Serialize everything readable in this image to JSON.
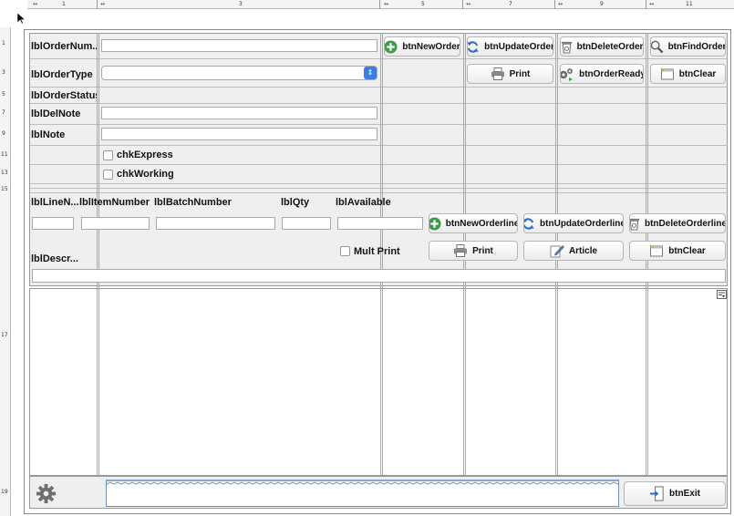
{
  "ruler": {
    "marks": [
      "1",
      "3",
      "5",
      "7",
      "9",
      "11"
    ],
    "left_marks": [
      "1",
      "3",
      "5",
      "7",
      "9",
      "11",
      "13",
      "15",
      "17",
      "19"
    ]
  },
  "order": {
    "labels": {
      "order_number": "lblOrderNum...",
      "order_type": "lblOrderType",
      "order_status": "lblOrderStatus",
      "del_note": "lblDelNote",
      "note": "lblNote"
    },
    "checkboxes": {
      "express": "chkExpress",
      "working": "chkWorking"
    },
    "buttons": {
      "new_order": "btnNewOrder",
      "update_order": "btnUpdateOrder",
      "delete_order": "btnDeleteOrder",
      "find_order": "btnFindOrder",
      "print": "Print",
      "order_ready": "btnOrderReady",
      "clear": "btnClear"
    }
  },
  "orderline": {
    "labels": {
      "line_number": "lblLineN...",
      "item_number": "lblItemNumber",
      "batch_number": "lblBatchNumber",
      "qty": "lblQty",
      "available": "lblAvailable",
      "description": "lblDescr..."
    },
    "checkboxes": {
      "mult_print": "Mult Print"
    },
    "buttons": {
      "new_orderline": "btnNewOrderline",
      "update_orderline": "btnUpdateOrderline",
      "delete_orderline": "btnDeleteOrderline",
      "print": "Print",
      "article": "Article",
      "clear": "btnClear"
    }
  },
  "footer": {
    "exit_button": "btnExit"
  },
  "icons": {
    "new": "plus-circle-icon",
    "update": "refresh-arrows-icon",
    "delete": "trash-icon",
    "find": "magnifier-icon",
    "print": "printer-icon",
    "ready": "gears-icon",
    "clear": "clear-window-icon",
    "article": "pencil-edit-icon",
    "exit": "exit-door-icon",
    "settings": "gear-icon"
  },
  "colors": {
    "accent": "#3b7de0",
    "panel": "#efefef",
    "wave": "#6e8fb5"
  }
}
